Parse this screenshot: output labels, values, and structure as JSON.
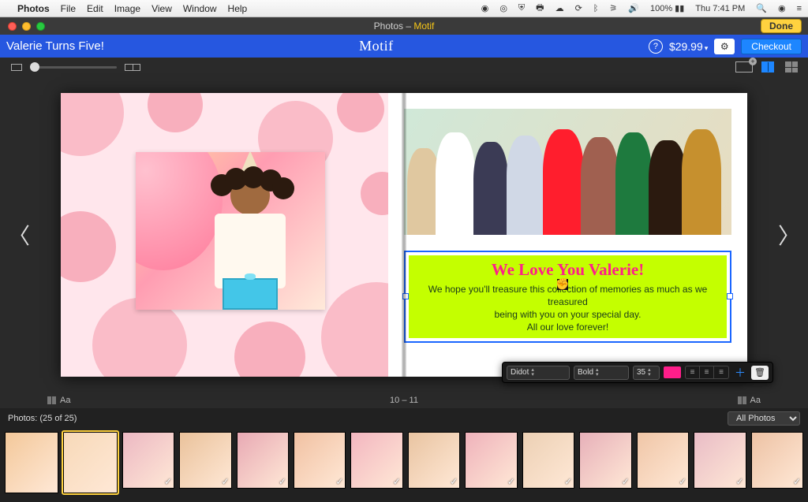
{
  "menubar": {
    "app": "Photos",
    "items": [
      "File",
      "Edit",
      "Image",
      "View",
      "Window",
      "Help"
    ],
    "battery": "100%",
    "clock": "Thu 7:41 PM"
  },
  "window": {
    "title_prefix": "Photos – ",
    "title_brand": "Motif",
    "done": "Done"
  },
  "header": {
    "project_title": "Valerie Turns Five!",
    "brand": "Motif",
    "price": "$29.99",
    "checkout": "Checkout"
  },
  "spread": {
    "page_label": "10 – 11",
    "text_block": {
      "title": "We Love You Valerie!",
      "line1": "We hope you'll treasure this collection of memories as much as we treasured",
      "line2": "being with you on your special day.",
      "line3": "All our love forever!"
    },
    "format_bar": {
      "font": "Didot",
      "weight": "Bold",
      "size": "35",
      "color": "#ff1e8a"
    }
  },
  "bottom": {
    "label": "Photos:",
    "count": "(25 of 25)",
    "filter": "All Photos",
    "thumb_count": 14
  }
}
